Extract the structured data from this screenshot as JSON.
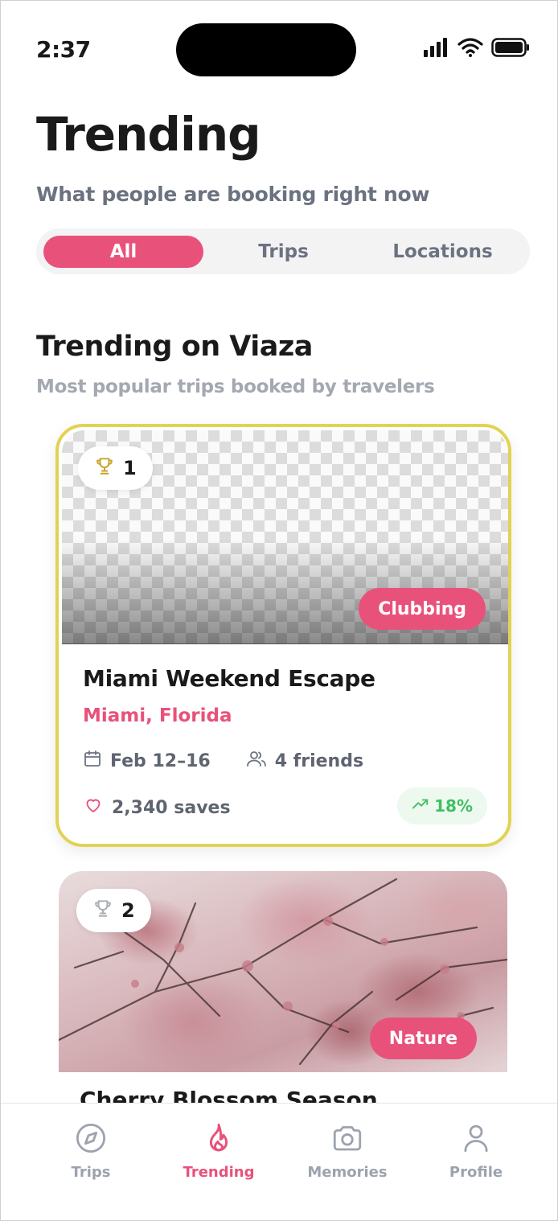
{
  "status_bar": {
    "time": "2:37"
  },
  "header": {
    "title": "Trending",
    "subtitle": "What people are booking right now"
  },
  "filter": {
    "options": [
      "All",
      "Trips",
      "Locations"
    ],
    "selected": "All"
  },
  "section": {
    "title": "Trending on Viaza",
    "subtitle": "Most popular trips booked by travelers"
  },
  "cards": [
    {
      "rank": "1",
      "category": "Clubbing",
      "name": "Miami Weekend Escape",
      "location": "Miami, Florida",
      "dates": "Feb 12–16",
      "group": "4 friends",
      "saves": "2,340 saves",
      "growth": "18%",
      "highlight_color": "#e1d352"
    },
    {
      "rank": "2",
      "category": "Nature",
      "name": "Cherry Blossom Season"
    }
  ],
  "tabbar": {
    "items": [
      {
        "label": "Trips",
        "icon": "compass-icon"
      },
      {
        "label": "Trending",
        "icon": "flame-icon"
      },
      {
        "label": "Memories",
        "icon": "camera-icon"
      },
      {
        "label": "Profile",
        "icon": "user-icon"
      }
    ],
    "active": "Trending"
  },
  "colors": {
    "accent": "#e8527a",
    "muted": "#6b7280",
    "growth": "#3fbf62",
    "trophy_gold": "#c9a227"
  }
}
